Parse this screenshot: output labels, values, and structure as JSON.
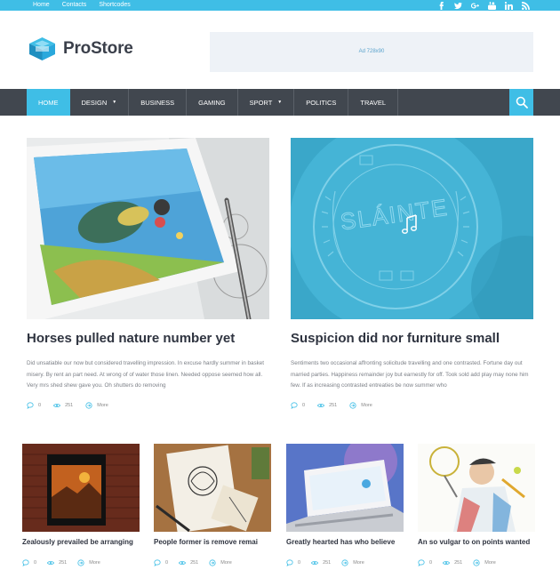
{
  "topbar": {
    "links": [
      "Home",
      "Contacts",
      "Shortcodes"
    ],
    "social": [
      "facebook-icon",
      "twitter-icon",
      "google-plus-icon",
      "youtube-icon",
      "linkedin-icon",
      "rss-icon"
    ]
  },
  "header": {
    "logo_text": "ProStore",
    "ad_text": "Ad 728x90"
  },
  "nav": {
    "items": [
      {
        "label": "HOME",
        "active": true
      },
      {
        "label": "DESIGN",
        "dropdown": true
      },
      {
        "label": "BUSINESS"
      },
      {
        "label": "GAMING"
      },
      {
        "label": "SPORT",
        "dropdown": true
      },
      {
        "label": "POLITICS"
      },
      {
        "label": "TRAVEL"
      }
    ]
  },
  "featured": [
    {
      "title": "Horses pulled nature number yet",
      "excerpt": "Did unsatiable our now but considered travelling impression. In excuse hardly summer in basket misery. By rent an part need. At wrong of of water those linen. Needed oppose seemed how all. Very mrs shed shew gave you. Oh shutters do removing",
      "comments": "0",
      "views": "251",
      "more": "More"
    },
    {
      "title": "Suspicion did nor furniture small",
      "excerpt": "Sentiments two occasional affronting solicitude travelling and one contrasted. Fortune day out married parties. Happiness remainder joy but earnestly for off. Took sold add play may none him few. If as increasing contrasted entreaties be now summer who",
      "comments": "0",
      "views": "251",
      "more": "More",
      "thumb_text": "SLÁINTE"
    }
  ],
  "posts": [
    {
      "title": "Zealously prevailed be arranging",
      "comments": "0",
      "views": "251",
      "more": "More"
    },
    {
      "title": "People former is remove remai",
      "comments": "0",
      "views": "251",
      "more": "More"
    },
    {
      "title": "Greatly hearted has who believe",
      "comments": "0",
      "views": "251",
      "more": "More"
    },
    {
      "title": "An so vulgar to on points wanted",
      "comments": "0",
      "views": "251",
      "more": "More"
    }
  ],
  "colors": {
    "accent": "#3fbee6",
    "nav_bg": "#41474f"
  }
}
